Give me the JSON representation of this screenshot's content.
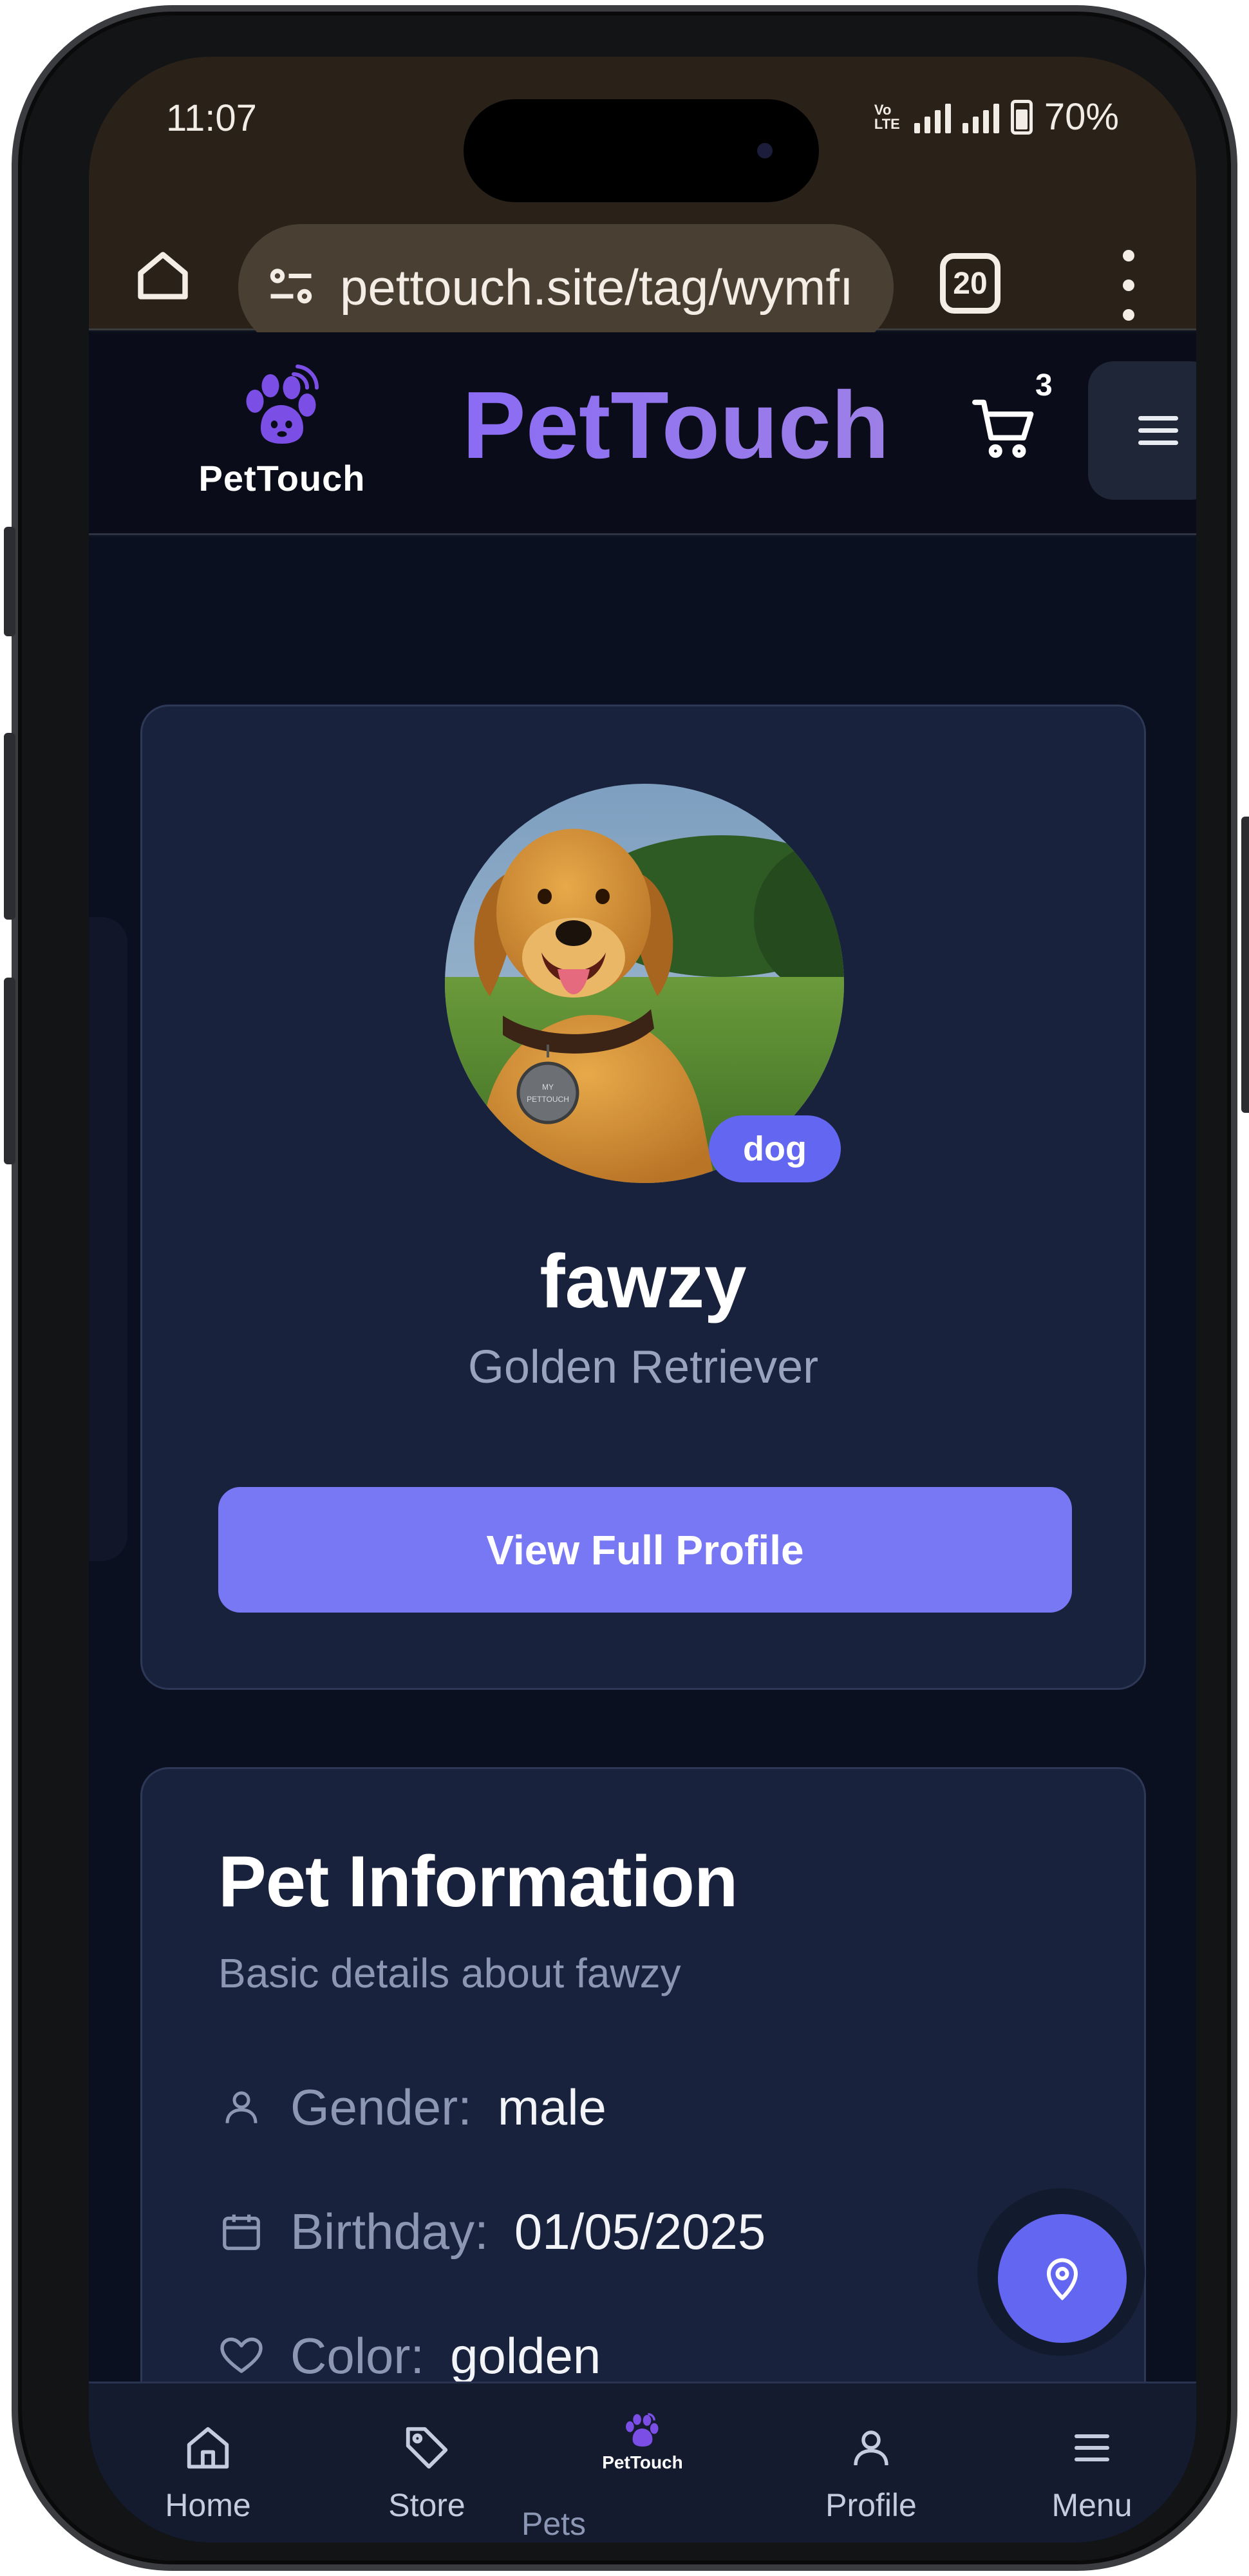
{
  "status_bar": {
    "time": "11:07",
    "network_label": "Vo LTE",
    "battery": "70%"
  },
  "browser": {
    "url": "pettouch.site/tag/wymfı",
    "tab_count": "20"
  },
  "header": {
    "logo_text": "PetTouch",
    "brand_title": "PetTouch",
    "cart_count": "3"
  },
  "pet_card": {
    "species_badge": "dog",
    "name": "fawzy",
    "breed": "Golden Retriever",
    "view_button": "View Full Profile",
    "tag_text_1": "MY",
    "tag_text_2": "PETTOUCH"
  },
  "pet_info": {
    "title": "Pet Information",
    "subtitle": "Basic details about fawzy",
    "rows": [
      {
        "label": "Gender:",
        "value": "male",
        "icon": "user-icon"
      },
      {
        "label": "Birthday:",
        "value": "01/05/2025",
        "icon": "calendar-icon"
      },
      {
        "label": "Color:",
        "value": "golden",
        "icon": "heart-icon"
      }
    ]
  },
  "bottom_nav": {
    "items": [
      {
        "label": "Home",
        "icon": "home-icon"
      },
      {
        "label": "Store",
        "icon": "tag-icon"
      },
      {
        "label": "PetTouch",
        "icon": "paw-logo-icon"
      },
      {
        "label": "Profile",
        "icon": "user-icon"
      },
      {
        "label": "Menu",
        "icon": "menu-icon"
      }
    ],
    "pets_label": "Pets"
  },
  "colors": {
    "accent": "#6366f1",
    "button": "#7878f4",
    "card": "#18223d",
    "background": "#0b1020",
    "brand_gradient": "#8b6cf5"
  }
}
